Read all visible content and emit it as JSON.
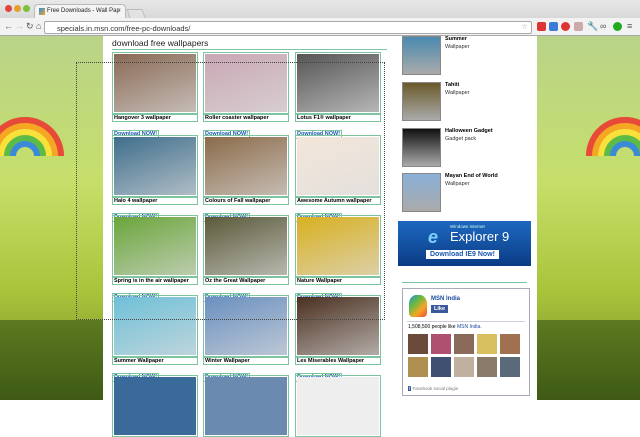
{
  "browser": {
    "tab_title": "Free Downloads - Wall Pap",
    "tab_close": "×",
    "url": "specials.in.msn.com/free-pc-downloads/"
  },
  "page": {
    "heading": "download free wallpapers",
    "download_label": "Download NOW!",
    "tiles": [
      {
        "caption": "Hangover 3 wallpaper",
        "color": "#8a6a55"
      },
      {
        "caption": "Roller coaster wallpaper",
        "color": "#c9a7b4"
      },
      {
        "caption": "Lotus F1® wallpaper",
        "color": "#555"
      },
      {
        "caption": "Halo 4 wallpaper",
        "color": "#3f6e8c"
      },
      {
        "caption": "Colours of Fall wallpaper",
        "color": "#8b6b4a"
      },
      {
        "caption": "Awesome Autumn wallpaper",
        "color": "#f3e6da"
      },
      {
        "caption": "Spring is in the air wallpaper",
        "color": "#6aa53a"
      },
      {
        "caption": "Oz the Great Wallpaper",
        "color": "#5a5a3a"
      },
      {
        "caption": "Nature Wallpaper",
        "color": "#d8b020"
      },
      {
        "caption": "Summer Wallpaper",
        "color": "#6ec0d8"
      },
      {
        "caption": "Winter Wallpaper",
        "color": "#6a90c0"
      },
      {
        "caption": "Les Miserables Wallpaper",
        "color": "#4a3020"
      }
    ]
  },
  "sidebar": {
    "items": [
      {
        "title": "Summer",
        "sub": "Wallpaper",
        "color": "#4a8ab0"
      },
      {
        "title": "Tahiti",
        "sub": "Wallpaper",
        "color": "#6a5a2a"
      },
      {
        "title": "Halloween Gadget",
        "sub": "Gadget pack",
        "color": "#111"
      },
      {
        "title": "Mayan End of World",
        "sub": "Wallpaper",
        "color": "#8ab0d8"
      }
    ],
    "ie_ad": {
      "small": "Windows Internet",
      "big": "Explorer 9",
      "button": "Download IE9 Now!"
    },
    "facebook": {
      "page": "MSN India",
      "like": "Like",
      "count_text": "1,508,500 people like",
      "count_link": "MSN India.",
      "plugin": "Facebook social plugin"
    }
  }
}
